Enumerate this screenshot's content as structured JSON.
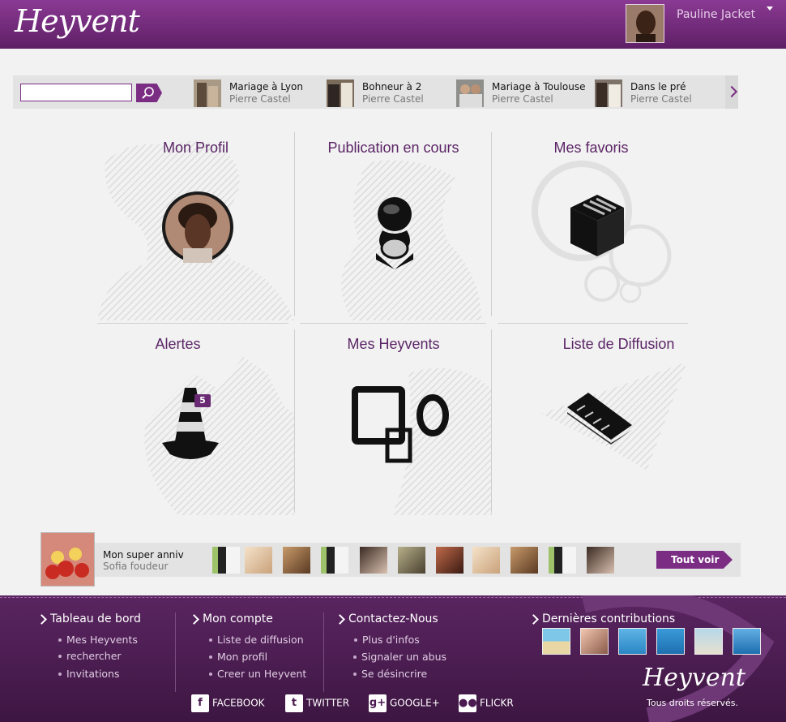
{
  "header": {
    "logo_text": "Heyvent",
    "user_name": "Pauline Jacket"
  },
  "search": {
    "value": ""
  },
  "top_events": [
    {
      "title": "Mariage à Lyon",
      "author": "Pierre Castel"
    },
    {
      "title": "Bohneur à 2",
      "author": "Pierre Castel"
    },
    {
      "title": "Mariage à Toulouse",
      "author": "Pierre Castel"
    },
    {
      "title": "Dans le pré",
      "author": "Pierre Castel"
    }
  ],
  "tiles": [
    {
      "title": "Mon Profil"
    },
    {
      "title": "Publication en cours"
    },
    {
      "title": "Mes favoris"
    },
    {
      "title": "Alertes",
      "badge": "5"
    },
    {
      "title": "Mes Heyvents"
    },
    {
      "title": "Liste de Diffusion"
    }
  ],
  "featured": {
    "title": "Mon super anniv",
    "author": "Sofia foudeur",
    "see_all_label": "Tout voir"
  },
  "footer": {
    "col1": {
      "title": "Tableau de bord",
      "links": [
        "Mes Heyvents",
        "rechercher",
        "Invitations"
      ]
    },
    "col2": {
      "title": "Mon compte",
      "links": [
        "Liste de diffusion",
        "Mon profil",
        "Creer un Heyvent"
      ]
    },
    "col3": {
      "title": "Contactez-Nous",
      "links": [
        "Plus d'infos",
        "Signaler un abus",
        "Se désincrire"
      ]
    },
    "contributions_title": "Dernières contributions",
    "social": [
      "FACEBOOK",
      "TWITTER",
      "GOOGLE+",
      "FLICKR"
    ],
    "logo_text": "Heyvent",
    "rights": "Tous droits réservés."
  },
  "colors": {
    "brand": "#7b2d84",
    "footer": "#4a1a50",
    "title": "#5b2566"
  }
}
